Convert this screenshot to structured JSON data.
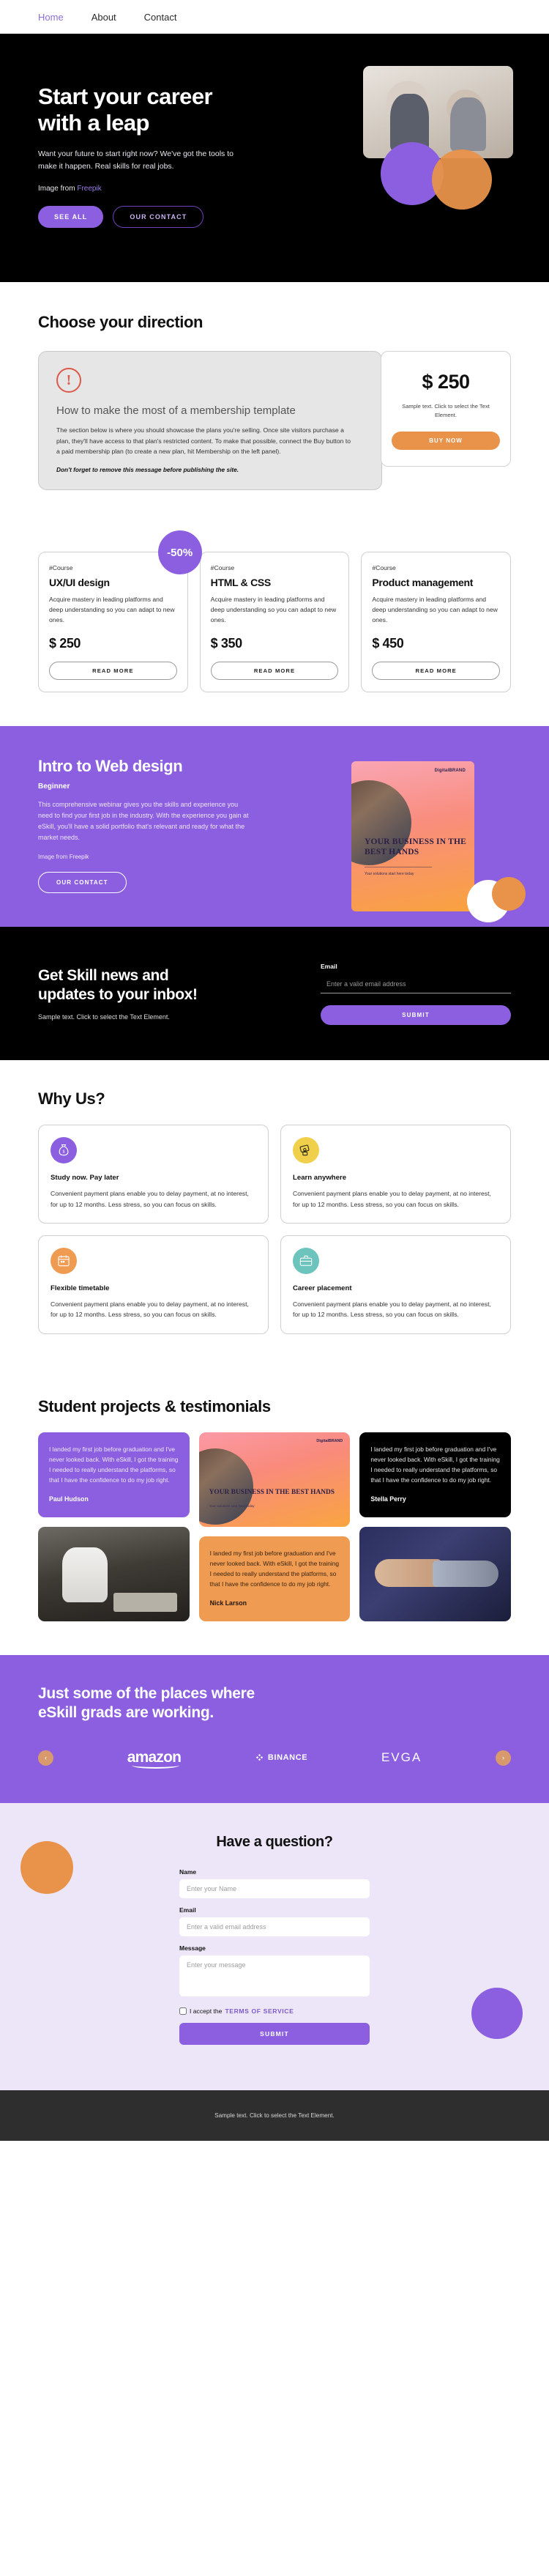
{
  "nav": {
    "items": [
      {
        "label": "Home",
        "active": true
      },
      {
        "label": "About",
        "active": false
      },
      {
        "label": "Contact",
        "active": false
      }
    ]
  },
  "hero": {
    "title_line1": "Start your career",
    "title_line2": "with a leap",
    "subtitle": "Want your future to start right now? We've got the tools to make it happen. Real skills for real jobs.",
    "credit_prefix": "Image from",
    "credit_link": "Freepik",
    "primary_button": "SEE ALL",
    "secondary_button": "OUR CONTACT"
  },
  "direction": {
    "heading": "Choose your direction",
    "notice": {
      "icon": "alert-icon",
      "title": "How to make the most of a membership template",
      "body": "The section below is where you should showcase the plans you're selling. Once site visitors purchase a plan, they'll have access to that plan's restricted content. To make that possible, connect the Buy button to a paid membership plan (to create a new plan, hit Membership on the left panel).",
      "warning": "Don't forget to remove this message before publishing the site."
    },
    "price_card": {
      "amount": "$ 250",
      "subtext": "Sample text. Click to select the Text Element.",
      "button": "BUY NOW"
    }
  },
  "courses": {
    "badge": "-50%",
    "items": [
      {
        "tag": "#Course",
        "title": "UX/UI design",
        "desc": "Acquire mastery in leading platforms and deep understanding so you can adapt to new ones.",
        "price": "$ 250",
        "button": "READ MORE"
      },
      {
        "tag": "#Course",
        "title": "HTML & CSS",
        "desc": "Acquire mastery in leading platforms and deep understanding so you can adapt to new ones.",
        "price": "$ 350",
        "button": "READ MORE"
      },
      {
        "tag": "#Course",
        "title": "Product management",
        "desc": "Acquire mastery in leading platforms and deep understanding so you can adapt to new ones.",
        "price": "$ 450",
        "button": "READ MORE"
      }
    ]
  },
  "intro": {
    "title": "Intro to Web design",
    "level": "Beginner",
    "text": "This comprehensive webinar gives you the skills and experience you need to find your first job in the industry. With the experience you gain at eSkill, you'll have a solid portfolio that's relevant and ready for what the market needs.",
    "credit_prefix": "Image from",
    "credit_link": "Freepik",
    "button": "OUR CONTACT",
    "poster": {
      "logo": "DigitalBRAND",
      "headline": "YOUR BUSINESS IN THE BEST HANDS",
      "sub": "Your solutions start here today"
    }
  },
  "newsletter": {
    "title_line1": "Get Skill news and",
    "title_line2": "updates to your inbox!",
    "subtitle": "Sample text. Click to select the Text Element.",
    "email_label": "Email",
    "email_placeholder": "Enter a valid email address",
    "email_value": "",
    "button": "SUBMIT"
  },
  "why": {
    "heading": "Why Us?",
    "cards": [
      {
        "icon": "money-bag-icon",
        "icon_bg": "#8b5fe0",
        "title": "Study now. Pay later",
        "desc": "Convenient payment plans enable you to delay payment, at no interest, for up to 12 months. Less stress, so you can focus on skills."
      },
      {
        "icon": "hand-card-icon",
        "icon_bg": "#f0d04a",
        "title": "Learn anywhere",
        "desc": "Convenient payment plans enable you to delay payment, at no interest, for up to 12 months. Less stress, so you can focus on skills."
      },
      {
        "icon": "calendar-icon",
        "icon_bg": "#ef9b52",
        "title": "Flexible timetable",
        "desc": "Convenient payment plans enable you to delay payment, at no interest, for up to 12 months. Less stress, so you can focus on skills."
      },
      {
        "icon": "briefcase-icon",
        "icon_bg": "#6cc4bd",
        "title": "Career placement",
        "desc": "Convenient payment plans enable you to delay payment, at no interest, for up to 12 months. Less stress, so you can focus on skills."
      }
    ]
  },
  "testimonials": {
    "heading": "Student projects & testimonials",
    "quote_text": "I landed my first job before graduation and I've never looked back. With eSkill, I got the training I needed to really understand the platforms, so that I have the confidence to do my job right.",
    "items": [
      {
        "name": "Paul Hudson",
        "style": "purple"
      },
      {
        "name": "Stella Perry",
        "style": "black"
      },
      {
        "name": "Nick Larson",
        "style": "orange"
      }
    ],
    "poster": {
      "logo": "DigitalBRAND",
      "headline": "YOUR BUSINESS IN THE BEST HANDS",
      "sub": "Your solutions start here today"
    }
  },
  "logos": {
    "title_line1": "Just some of the places where",
    "title_line2": "eSkill grads are working.",
    "prev": "‹",
    "next": "›",
    "brands": [
      "amazon",
      "BINANCE",
      "EVGA"
    ]
  },
  "contact": {
    "title": "Have a question?",
    "name_label": "Name",
    "name_placeholder": "Enter your Name",
    "name_value": "",
    "email_label": "Email",
    "email_placeholder": "Enter a valid email address",
    "email_value": "",
    "message_label": "Message",
    "message_placeholder": "Enter your message",
    "message_value": "",
    "consent_prefix": "I accept the",
    "consent_link": "TERMS OF SERVICE",
    "button": "SUBMIT"
  },
  "footer": {
    "text": "Sample text. Click to select the Text Element."
  }
}
